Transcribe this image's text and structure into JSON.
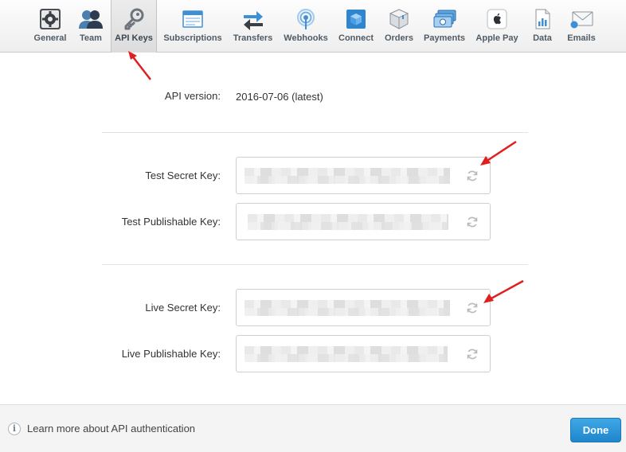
{
  "toolbar": {
    "tabs": [
      {
        "label": "General",
        "icon": "gear-icon"
      },
      {
        "label": "Team",
        "icon": "users-icon"
      },
      {
        "label": "API Keys",
        "icon": "key-icon",
        "active": true
      },
      {
        "label": "Subscriptions",
        "icon": "browser-window-icon"
      },
      {
        "label": "Transfers",
        "icon": "transfer-arrows-icon"
      },
      {
        "label": "Webhooks",
        "icon": "broadcast-icon"
      },
      {
        "label": "Connect",
        "icon": "cube-icon"
      },
      {
        "label": "Orders",
        "icon": "box-icon"
      },
      {
        "label": "Payments",
        "icon": "money-icon"
      },
      {
        "label": "Apple Pay",
        "icon": "apple-icon"
      },
      {
        "label": "Data",
        "icon": "document-chart-icon"
      },
      {
        "label": "Emails",
        "icon": "envelope-icon"
      }
    ]
  },
  "api": {
    "version_label": "API version:",
    "version_value": "2016-07-06 (latest)"
  },
  "keys": {
    "test_secret_label": "Test Secret Key:",
    "test_publishable_label": "Test Publishable Key:",
    "live_secret_label": "Live Secret Key:",
    "live_publishable_label": "Live Publishable Key:"
  },
  "footer": {
    "learn_more": "Learn more about API authentication",
    "done_label": "Done"
  },
  "colors": {
    "accent": "#2a93d8",
    "annotation": "#e02020"
  }
}
